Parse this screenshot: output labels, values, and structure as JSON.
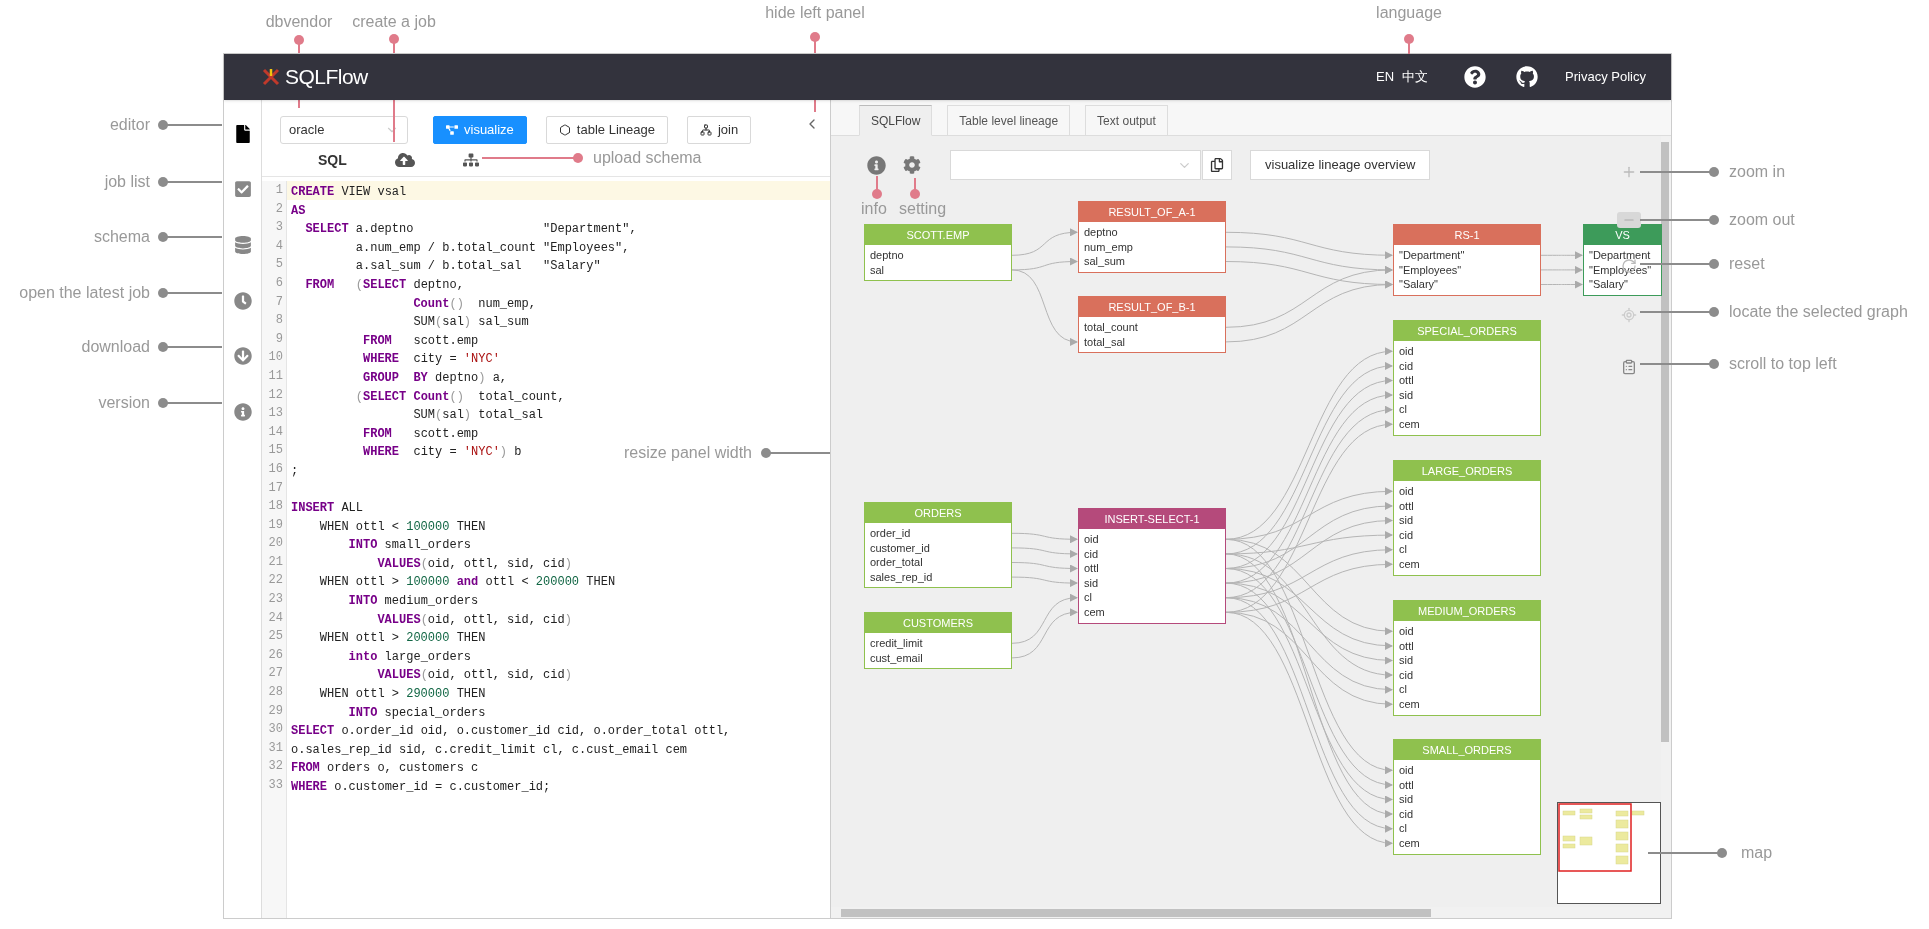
{
  "annotations": [
    {
      "text": "dbvendor",
      "color": "#e07b8a"
    },
    {
      "text": "create a job",
      "color": "#e07b8a"
    },
    {
      "text": "hide left panel",
      "color": "#e07b8a"
    },
    {
      "text": "language",
      "color": "#e07b8a"
    },
    {
      "text": "editor",
      "color": "#8c8c8c"
    },
    {
      "text": "job list",
      "color": "#8c8c8c"
    },
    {
      "text": "schema",
      "color": "#8c8c8c"
    },
    {
      "text": "open the latest job",
      "color": "#8c8c8c"
    },
    {
      "text": "download",
      "color": "#8c8c8c"
    },
    {
      "text": "version",
      "color": "#8c8c8c"
    },
    {
      "text": "upload schema",
      "color": "#e07b8a"
    },
    {
      "text": "info",
      "color": "#e07b8a"
    },
    {
      "text": "setting",
      "color": "#e07b8a"
    },
    {
      "text": "resize panel width",
      "color": "#8c8c8c"
    },
    {
      "text": "zoom in",
      "color": "#8c8c8c"
    },
    {
      "text": "zoom out",
      "color": "#8c8c8c"
    },
    {
      "text": "reset",
      "color": "#8c8c8c"
    },
    {
      "text": "locate the selected graph",
      "color": "#8c8c8c"
    },
    {
      "text": "scroll to top left",
      "color": "#8c8c8c"
    },
    {
      "text": "map",
      "color": "#8c8c8c"
    }
  ],
  "header": {
    "logo": "SQLFlow",
    "languages": [
      "EN",
      "中文"
    ],
    "link": "Privacy Policy"
  },
  "sidebar": {
    "items": [
      {
        "kind": "editor",
        "selected": true
      },
      {
        "kind": "jobs",
        "selected": false
      },
      {
        "kind": "schema",
        "selected": false
      },
      {
        "kind": "latest",
        "selected": false
      },
      {
        "kind": "download",
        "selected": false
      },
      {
        "kind": "version",
        "selected": false
      }
    ]
  },
  "editor": {
    "dbvendor": "oracle",
    "buttons": [
      {
        "kind": "visualize",
        "label": "visualize",
        "selected": true
      },
      {
        "kind": "lineage",
        "label": "table Lineage",
        "selected": false
      },
      {
        "kind": "join",
        "label": "join",
        "selected": false
      }
    ],
    "tab": "SQL",
    "lines": [
      {
        "number": "1",
        "active": true,
        "tokens": [
          {
            "kind": "keyword",
            "text": "CREATE"
          },
          {
            "kind": "plain",
            "text": " VIEW vsal"
          }
        ]
      },
      {
        "number": "2",
        "active": false,
        "tokens": [
          {
            "kind": "keyword",
            "text": "AS"
          }
        ]
      },
      {
        "number": "3",
        "active": false,
        "tokens": [
          {
            "kind": "keyword",
            "text": "  SELECT"
          },
          {
            "kind": "plain",
            "text": " a.deptno                  \"Department\","
          }
        ]
      },
      {
        "number": "4",
        "active": false,
        "tokens": [
          {
            "kind": "plain",
            "text": "         a.num_emp / b.total_count \"Employees\","
          }
        ]
      },
      {
        "number": "5",
        "active": false,
        "tokens": [
          {
            "kind": "plain",
            "text": "         a.sal_sum / b.total_sal   \"Salary\""
          }
        ]
      },
      {
        "number": "6",
        "active": false,
        "tokens": [
          {
            "kind": "keyword",
            "text": "  FROM   "
          },
          {
            "kind": "punct",
            "text": "("
          },
          {
            "kind": "keyword",
            "text": "SELECT"
          },
          {
            "kind": "plain",
            "text": " deptno,"
          }
        ]
      },
      {
        "number": "7",
        "active": false,
        "tokens": [
          {
            "kind": "keyword",
            "text": "                 Count"
          },
          {
            "kind": "punct",
            "text": "()"
          },
          {
            "kind": "plain",
            "text": "  num_emp,"
          }
        ]
      },
      {
        "number": "8",
        "active": false,
        "tokens": [
          {
            "kind": "plain",
            "text": "                 SUM"
          },
          {
            "kind": "punct",
            "text": "("
          },
          {
            "kind": "plain",
            "text": "sal"
          },
          {
            "kind": "punct",
            "text": ")"
          },
          {
            "kind": "plain",
            "text": " sal_sum"
          }
        ]
      },
      {
        "number": "9",
        "active": false,
        "tokens": [
          {
            "kind": "keyword",
            "text": "          FROM"
          },
          {
            "kind": "plain",
            "text": "   scott.emp"
          }
        ]
      },
      {
        "number": "10",
        "active": false,
        "tokens": [
          {
            "kind": "keyword",
            "text": "          WHERE"
          },
          {
            "kind": "plain",
            "text": "  city = "
          },
          {
            "kind": "string",
            "text": "'NYC'"
          }
        ]
      },
      {
        "number": "11",
        "active": false,
        "tokens": [
          {
            "kind": "keyword",
            "text": "          GROUP  BY"
          },
          {
            "kind": "plain",
            "text": " deptno"
          },
          {
            "kind": "punct",
            "text": ")"
          },
          {
            "kind": "plain",
            "text": " a,"
          }
        ]
      },
      {
        "number": "12",
        "active": false,
        "tokens": [
          {
            "kind": "punct",
            "text": "         ("
          },
          {
            "kind": "keyword",
            "text": "SELECT Count"
          },
          {
            "kind": "punct",
            "text": "()"
          },
          {
            "kind": "plain",
            "text": "  total_count,"
          }
        ]
      },
      {
        "number": "13",
        "active": false,
        "tokens": [
          {
            "kind": "plain",
            "text": "                 SUM"
          },
          {
            "kind": "punct",
            "text": "("
          },
          {
            "kind": "plain",
            "text": "sal"
          },
          {
            "kind": "punct",
            "text": ")"
          },
          {
            "kind": "plain",
            "text": " total_sal"
          }
        ]
      },
      {
        "number": "14",
        "active": false,
        "tokens": [
          {
            "kind": "keyword",
            "text": "          FROM"
          },
          {
            "kind": "plain",
            "text": "   scott.emp"
          }
        ]
      },
      {
        "number": "15",
        "active": false,
        "tokens": [
          {
            "kind": "keyword",
            "text": "          WHERE"
          },
          {
            "kind": "plain",
            "text": "  city = "
          },
          {
            "kind": "string",
            "text": "'NYC'"
          },
          {
            "kind": "punct",
            "text": ")"
          },
          {
            "kind": "plain",
            "text": " b"
          }
        ]
      },
      {
        "number": "16",
        "active": false,
        "tokens": [
          {
            "kind": "plain",
            "text": ";"
          }
        ]
      },
      {
        "number": "17",
        "active": false
      },
      {
        "number": "18",
        "active": false,
        "tokens": [
          {
            "kind": "keyword",
            "text": "INSERT"
          },
          {
            "kind": "plain",
            "text": " ALL"
          }
        ]
      },
      {
        "number": "19",
        "active": false,
        "tokens": [
          {
            "kind": "plain",
            "text": "    WHEN ottl < "
          },
          {
            "kind": "number",
            "text": "100000"
          },
          {
            "kind": "plain",
            "text": " THEN"
          }
        ]
      },
      {
        "number": "20",
        "active": false,
        "tokens": [
          {
            "kind": "keyword",
            "text": "        INTO"
          },
          {
            "kind": "plain",
            "text": " small_orders"
          }
        ]
      },
      {
        "number": "21",
        "active": false,
        "tokens": [
          {
            "kind": "keyword",
            "text": "            VALUES"
          },
          {
            "kind": "punct",
            "text": "("
          },
          {
            "kind": "plain",
            "text": "oid, ottl, sid, cid"
          },
          {
            "kind": "punct",
            "text": ")"
          }
        ]
      },
      {
        "number": "22",
        "active": false,
        "tokens": [
          {
            "kind": "plain",
            "text": "    WHEN ottl > "
          },
          {
            "kind": "number",
            "text": "100000"
          },
          {
            "kind": "keyword",
            "text": " and"
          },
          {
            "kind": "plain",
            "text": " ottl < "
          },
          {
            "kind": "number",
            "text": "200000"
          },
          {
            "kind": "plain",
            "text": " THEN"
          }
        ]
      },
      {
        "number": "23",
        "active": false,
        "tokens": [
          {
            "kind": "keyword",
            "text": "        INTO"
          },
          {
            "kind": "plain",
            "text": " medium_orders"
          }
        ]
      },
      {
        "number": "24",
        "active": false,
        "tokens": [
          {
            "kind": "keyword",
            "text": "            VALUES"
          },
          {
            "kind": "punct",
            "text": "("
          },
          {
            "kind": "plain",
            "text": "oid, ottl, sid, cid"
          },
          {
            "kind": "punct",
            "text": ")"
          }
        ]
      },
      {
        "number": "25",
        "active": false,
        "tokens": [
          {
            "kind": "plain",
            "text": "    WHEN ottl > "
          },
          {
            "kind": "number",
            "text": "200000"
          },
          {
            "kind": "plain",
            "text": " THEN"
          }
        ]
      },
      {
        "number": "26",
        "active": false,
        "tokens": [
          {
            "kind": "keyword",
            "text": "        into"
          },
          {
            "kind": "plain",
            "text": " large_orders"
          }
        ]
      },
      {
        "number": "27",
        "active": false,
        "tokens": [
          {
            "kind": "keyword",
            "text": "            VALUES"
          },
          {
            "kind": "punct",
            "text": "("
          },
          {
            "kind": "plain",
            "text": "oid, ottl, sid, cid"
          },
          {
            "kind": "punct",
            "text": ")"
          }
        ]
      },
      {
        "number": "28",
        "active": false,
        "tokens": [
          {
            "kind": "plain",
            "text": "    WHEN ottl > "
          },
          {
            "kind": "number",
            "text": "290000"
          },
          {
            "kind": "plain",
            "text": " THEN"
          }
        ]
      },
      {
        "number": "29",
        "active": false,
        "tokens": [
          {
            "kind": "keyword",
            "text": "        INTO"
          },
          {
            "kind": "plain",
            "text": " special_orders"
          }
        ]
      },
      {
        "number": "30",
        "active": false,
        "tokens": [
          {
            "kind": "keyword",
            "text": "SELECT"
          },
          {
            "kind": "plain",
            "text": " o.order_id oid, o.customer_id cid, o.order_total ottl,"
          }
        ]
      },
      {
        "number": "31",
        "active": false,
        "tokens": [
          {
            "kind": "plain",
            "text": "o.sales_rep_id sid, c.credit_limit cl, c.cust_email cem"
          }
        ]
      },
      {
        "number": "32",
        "active": false,
        "tokens": [
          {
            "kind": "keyword",
            "text": "FROM"
          },
          {
            "kind": "plain",
            "text": " orders o, customers c"
          }
        ]
      },
      {
        "number": "33",
        "active": false,
        "tokens": [
          {
            "kind": "keyword",
            "text": "WHERE"
          },
          {
            "kind": "plain",
            "text": " o.customer_id = c.customer_id;"
          }
        ]
      }
    ]
  },
  "graph": {
    "tabs": [
      {
        "label": "SQLFlow",
        "selected": true
      },
      {
        "label": "Table level lineage",
        "selected": false
      },
      {
        "label": "Text output",
        "selected": false
      }
    ],
    "overview_button": "visualize lineage overview",
    "nodes": [
      {
        "title": "SCOTT.EMP",
        "kind": "table",
        "rows": [
          "deptno",
          "sal"
        ]
      },
      {
        "title": "RESULT_OF_A-1",
        "kind": "result",
        "rows": [
          "deptno",
          "num_emp",
          "sal_sum"
        ]
      },
      {
        "title": "RESULT_OF_B-1",
        "kind": "result",
        "rows": [
          "total_count",
          "total_sal"
        ]
      },
      {
        "title": "RS-1",
        "kind": "result",
        "rows": [
          "\"Department\"",
          "\"Employees\"",
          "\"Salary\""
        ]
      },
      {
        "title": "VS",
        "kind": "view",
        "rows": [
          "\"Department",
          "\"Employees\"",
          "\"Salary\""
        ]
      },
      {
        "title": "SPECIAL_ORDERS",
        "kind": "table",
        "rows": [
          "oid",
          "cid",
          "ottl",
          "sid",
          "cl",
          "cem"
        ]
      },
      {
        "title": "LARGE_ORDERS",
        "kind": "table",
        "rows": [
          "oid",
          "ottl",
          "sid",
          "cid",
          "cl",
          "cem"
        ]
      },
      {
        "title": "MEDIUM_ORDERS",
        "kind": "table",
        "rows": [
          "oid",
          "ottl",
          "sid",
          "cid",
          "cl",
          "cem"
        ]
      },
      {
        "title": "SMALL_ORDERS",
        "kind": "table",
        "rows": [
          "oid",
          "ottl",
          "sid",
          "cid",
          "cl",
          "cem"
        ]
      },
      {
        "title": "ORDERS",
        "kind": "table",
        "rows": [
          "order_id",
          "customer_id",
          "order_total",
          "sales_rep_id"
        ]
      },
      {
        "title": "CUSTOMERS",
        "kind": "table",
        "rows": [
          "credit_limit",
          "cust_email"
        ]
      },
      {
        "title": "INSERT-SELECT-1",
        "kind": "insert",
        "rows": [
          "oid",
          "cid",
          "ottl",
          "sid",
          "cl",
          "cem"
        ]
      }
    ]
  }
}
